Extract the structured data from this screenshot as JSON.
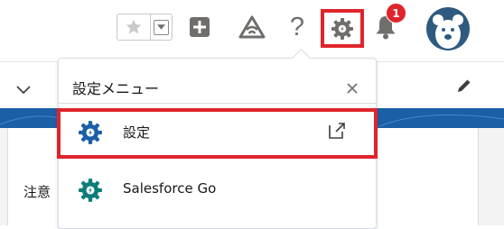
{
  "header": {
    "favorites_star_icon": "star-icon",
    "favorites_menu_icon": "chevron-down-icon",
    "add_icon": "plus-square-icon",
    "trailhead_icon": "trailhead-icon",
    "help_icon": "question-mark-icon",
    "setup_icon": "gear-icon",
    "notifications_icon": "bell-icon",
    "notification_count": "1",
    "avatar_icon": "bear-avatar-icon",
    "help_glyph": "?"
  },
  "menu": {
    "title": "設定メニュー",
    "close_glyph": "×",
    "items": [
      {
        "label": "設定",
        "icon": "setup-gear-icon",
        "external_icon": "external-link-icon"
      },
      {
        "label": "Salesforce Go",
        "icon": "setup-gear-icon"
      }
    ]
  },
  "page": {
    "notice_label": "注意"
  },
  "colors": {
    "highlight": "#e0242b",
    "icon_gray": "#706e6b",
    "setup_gear_teal": "#0d7d7a",
    "setup_gear_blue": "#1b5fa6",
    "avatar_bg": "#2e5a7e",
    "banner": "#1b5fa6"
  }
}
